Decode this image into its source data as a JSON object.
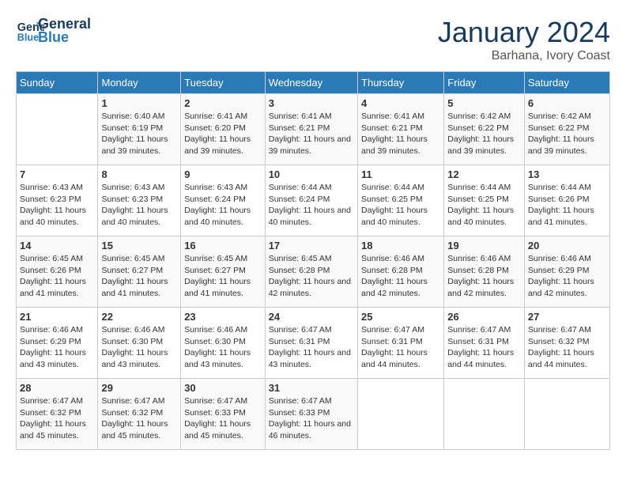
{
  "logo": {
    "line1": "General",
    "line2": "Blue"
  },
  "title": "January 2024",
  "subtitle": "Barhana, Ivory Coast",
  "days_header": [
    "Sunday",
    "Monday",
    "Tuesday",
    "Wednesday",
    "Thursday",
    "Friday",
    "Saturday"
  ],
  "weeks": [
    [
      {
        "day": "",
        "sunrise": "",
        "sunset": "",
        "daylight": ""
      },
      {
        "day": "1",
        "sunrise": "Sunrise: 6:40 AM",
        "sunset": "Sunset: 6:19 PM",
        "daylight": "Daylight: 11 hours and 39 minutes."
      },
      {
        "day": "2",
        "sunrise": "Sunrise: 6:41 AM",
        "sunset": "Sunset: 6:20 PM",
        "daylight": "Daylight: 11 hours and 39 minutes."
      },
      {
        "day": "3",
        "sunrise": "Sunrise: 6:41 AM",
        "sunset": "Sunset: 6:21 PM",
        "daylight": "Daylight: 11 hours and 39 minutes."
      },
      {
        "day": "4",
        "sunrise": "Sunrise: 6:41 AM",
        "sunset": "Sunset: 6:21 PM",
        "daylight": "Daylight: 11 hours and 39 minutes."
      },
      {
        "day": "5",
        "sunrise": "Sunrise: 6:42 AM",
        "sunset": "Sunset: 6:22 PM",
        "daylight": "Daylight: 11 hours and 39 minutes."
      },
      {
        "day": "6",
        "sunrise": "Sunrise: 6:42 AM",
        "sunset": "Sunset: 6:22 PM",
        "daylight": "Daylight: 11 hours and 39 minutes."
      }
    ],
    [
      {
        "day": "7",
        "sunrise": "Sunrise: 6:43 AM",
        "sunset": "Sunset: 6:23 PM",
        "daylight": "Daylight: 11 hours and 40 minutes."
      },
      {
        "day": "8",
        "sunrise": "Sunrise: 6:43 AM",
        "sunset": "Sunset: 6:23 PM",
        "daylight": "Daylight: 11 hours and 40 minutes."
      },
      {
        "day": "9",
        "sunrise": "Sunrise: 6:43 AM",
        "sunset": "Sunset: 6:24 PM",
        "daylight": "Daylight: 11 hours and 40 minutes."
      },
      {
        "day": "10",
        "sunrise": "Sunrise: 6:44 AM",
        "sunset": "Sunset: 6:24 PM",
        "daylight": "Daylight: 11 hours and 40 minutes."
      },
      {
        "day": "11",
        "sunrise": "Sunrise: 6:44 AM",
        "sunset": "Sunset: 6:25 PM",
        "daylight": "Daylight: 11 hours and 40 minutes."
      },
      {
        "day": "12",
        "sunrise": "Sunrise: 6:44 AM",
        "sunset": "Sunset: 6:25 PM",
        "daylight": "Daylight: 11 hours and 40 minutes."
      },
      {
        "day": "13",
        "sunrise": "Sunrise: 6:44 AM",
        "sunset": "Sunset: 6:26 PM",
        "daylight": "Daylight: 11 hours and 41 minutes."
      }
    ],
    [
      {
        "day": "14",
        "sunrise": "Sunrise: 6:45 AM",
        "sunset": "Sunset: 6:26 PM",
        "daylight": "Daylight: 11 hours and 41 minutes."
      },
      {
        "day": "15",
        "sunrise": "Sunrise: 6:45 AM",
        "sunset": "Sunset: 6:27 PM",
        "daylight": "Daylight: 11 hours and 41 minutes."
      },
      {
        "day": "16",
        "sunrise": "Sunrise: 6:45 AM",
        "sunset": "Sunset: 6:27 PM",
        "daylight": "Daylight: 11 hours and 41 minutes."
      },
      {
        "day": "17",
        "sunrise": "Sunrise: 6:45 AM",
        "sunset": "Sunset: 6:28 PM",
        "daylight": "Daylight: 11 hours and 42 minutes."
      },
      {
        "day": "18",
        "sunrise": "Sunrise: 6:46 AM",
        "sunset": "Sunset: 6:28 PM",
        "daylight": "Daylight: 11 hours and 42 minutes."
      },
      {
        "day": "19",
        "sunrise": "Sunrise: 6:46 AM",
        "sunset": "Sunset: 6:28 PM",
        "daylight": "Daylight: 11 hours and 42 minutes."
      },
      {
        "day": "20",
        "sunrise": "Sunrise: 6:46 AM",
        "sunset": "Sunset: 6:29 PM",
        "daylight": "Daylight: 11 hours and 42 minutes."
      }
    ],
    [
      {
        "day": "21",
        "sunrise": "Sunrise: 6:46 AM",
        "sunset": "Sunset: 6:29 PM",
        "daylight": "Daylight: 11 hours and 43 minutes."
      },
      {
        "day": "22",
        "sunrise": "Sunrise: 6:46 AM",
        "sunset": "Sunset: 6:30 PM",
        "daylight": "Daylight: 11 hours and 43 minutes."
      },
      {
        "day": "23",
        "sunrise": "Sunrise: 6:46 AM",
        "sunset": "Sunset: 6:30 PM",
        "daylight": "Daylight: 11 hours and 43 minutes."
      },
      {
        "day": "24",
        "sunrise": "Sunrise: 6:47 AM",
        "sunset": "Sunset: 6:31 PM",
        "daylight": "Daylight: 11 hours and 43 minutes."
      },
      {
        "day": "25",
        "sunrise": "Sunrise: 6:47 AM",
        "sunset": "Sunset: 6:31 PM",
        "daylight": "Daylight: 11 hours and 44 minutes."
      },
      {
        "day": "26",
        "sunrise": "Sunrise: 6:47 AM",
        "sunset": "Sunset: 6:31 PM",
        "daylight": "Daylight: 11 hours and 44 minutes."
      },
      {
        "day": "27",
        "sunrise": "Sunrise: 6:47 AM",
        "sunset": "Sunset: 6:32 PM",
        "daylight": "Daylight: 11 hours and 44 minutes."
      }
    ],
    [
      {
        "day": "28",
        "sunrise": "Sunrise: 6:47 AM",
        "sunset": "Sunset: 6:32 PM",
        "daylight": "Daylight: 11 hours and 45 minutes."
      },
      {
        "day": "29",
        "sunrise": "Sunrise: 6:47 AM",
        "sunset": "Sunset: 6:32 PM",
        "daylight": "Daylight: 11 hours and 45 minutes."
      },
      {
        "day": "30",
        "sunrise": "Sunrise: 6:47 AM",
        "sunset": "Sunset: 6:33 PM",
        "daylight": "Daylight: 11 hours and 45 minutes."
      },
      {
        "day": "31",
        "sunrise": "Sunrise: 6:47 AM",
        "sunset": "Sunset: 6:33 PM",
        "daylight": "Daylight: 11 hours and 46 minutes."
      },
      {
        "day": "",
        "sunrise": "",
        "sunset": "",
        "daylight": ""
      },
      {
        "day": "",
        "sunrise": "",
        "sunset": "",
        "daylight": ""
      },
      {
        "day": "",
        "sunrise": "",
        "sunset": "",
        "daylight": ""
      }
    ]
  ]
}
